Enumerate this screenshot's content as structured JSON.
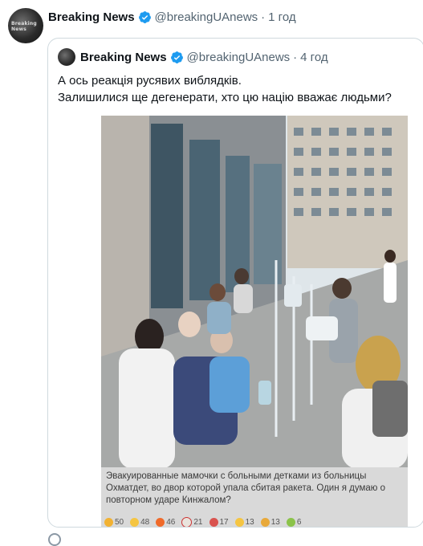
{
  "outer_tweet": {
    "name": "Breaking News",
    "handle": "@breakingUAnews",
    "separator": "·",
    "time": "1 год",
    "avatar_label": "Breaking News"
  },
  "quoted_tweet": {
    "name": "Breaking News",
    "handle": "@breakingUAnews",
    "separator": "·",
    "time": "4 год",
    "text_line1": "А ось реакція русявих виблядків.",
    "text_line2": "Залишилися ще дегенерати, хто цю націю вважає людьми?"
  },
  "photo": {
    "caption": "Эвакуированные мамочки с больными детками из больницы Охматдет, во двор которой упала сбитая ракета. Один я думаю о повторном ударе Кинжалом?",
    "reactions": [
      {
        "icon": "thumbs-up-icon",
        "count": "50",
        "color": "#f2b233"
      },
      {
        "icon": "laughing-face-icon",
        "count": "48",
        "color": "#f5c542"
      },
      {
        "icon": "fire-icon",
        "count": "46",
        "color": "#f06a2a"
      },
      {
        "icon": "clown-face-icon",
        "count": "21",
        "color": "#e9e4dd"
      },
      {
        "icon": "angry-face-icon",
        "count": "17",
        "color": "#d9534f"
      },
      {
        "icon": "smirk-face-icon",
        "count": "13",
        "color": "#f5c542"
      },
      {
        "icon": "party-icon",
        "count": "13",
        "color": "#e8a93a"
      },
      {
        "icon": "vomit-face-icon",
        "count": "6",
        "color": "#8bc34a"
      }
    ]
  },
  "colors": {
    "verified": "#1d9bf0",
    "muted": "#536471",
    "border": "#cfd9de"
  }
}
